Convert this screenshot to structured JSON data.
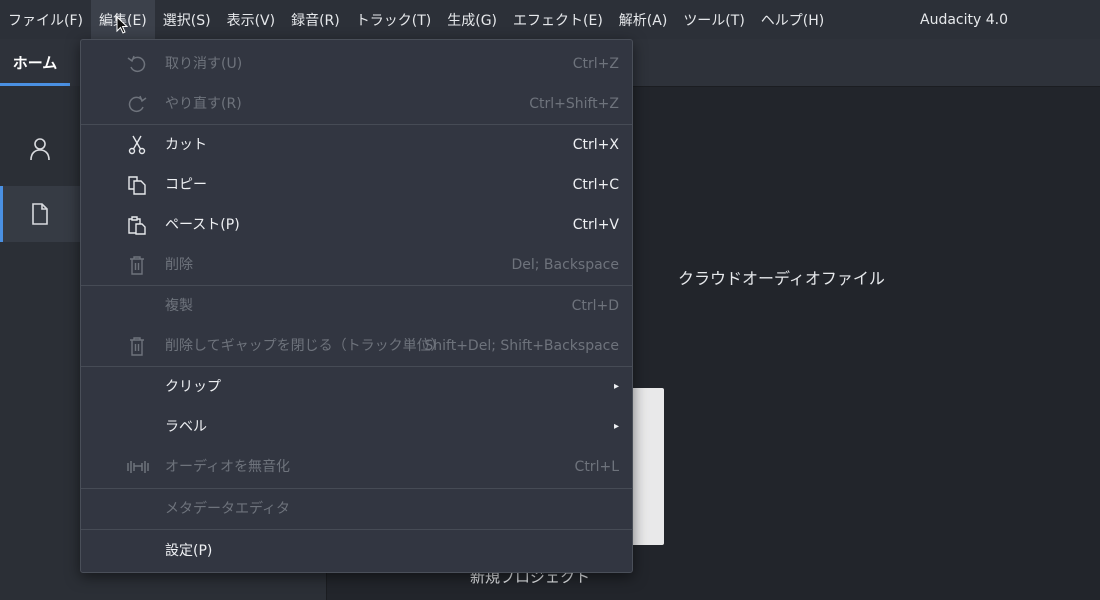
{
  "menubar": {
    "items": [
      "ファイル(F)",
      "編集(E)",
      "選択(S)",
      "表示(V)",
      "録音(R)",
      "トラック(T)",
      "生成(G)",
      "エフェクト(E)",
      "解析(A)",
      "ツール(T)",
      "ヘルプ(H)"
    ],
    "app_title": "Audacity 4.0"
  },
  "tabs": {
    "home": "ホーム"
  },
  "sidebar": {
    "icons": [
      "user-icon",
      "document-icon"
    ]
  },
  "content": {
    "cloud_audio_label": "クラウドオーディオファイル",
    "new_project_label": "新規プロジェクト"
  },
  "edit_menu": {
    "items": [
      {
        "label": "取り消す(U)",
        "shortcut": "Ctrl+Z",
        "enabled": false,
        "icon": "undo-icon"
      },
      {
        "label": "やり直す(R)",
        "shortcut": "Ctrl+Shift+Z",
        "enabled": false,
        "icon": "redo-icon"
      },
      {
        "label": "カット",
        "shortcut": "Ctrl+X",
        "enabled": true,
        "icon": "scissors-icon"
      },
      {
        "label": "コピー",
        "shortcut": "Ctrl+C",
        "enabled": true,
        "icon": "copy-icon"
      },
      {
        "label": "ペースト(P)",
        "shortcut": "Ctrl+V",
        "enabled": true,
        "icon": "paste-icon"
      },
      {
        "label": "削除",
        "shortcut": "Del; Backspace",
        "enabled": false,
        "icon": "trash-icon"
      },
      {
        "label": "複製",
        "shortcut": "Ctrl+D",
        "enabled": false,
        "icon": ""
      },
      {
        "label": "削除してギャップを閉じる（トラック単位）",
        "shortcut": "Shift+Del; Shift+Backspace",
        "enabled": false,
        "icon": "trash-icon"
      },
      {
        "label": "クリップ",
        "shortcut": "",
        "enabled": true,
        "icon": "",
        "submenu": true
      },
      {
        "label": "ラベル",
        "shortcut": "",
        "enabled": true,
        "icon": "",
        "submenu": true
      },
      {
        "label": "オーディオを無音化",
        "shortcut": "Ctrl+L",
        "enabled": false,
        "icon": "silence-icon"
      },
      {
        "label": "メタデータエディタ",
        "shortcut": "",
        "enabled": false,
        "icon": ""
      },
      {
        "label": "設定(P)",
        "shortcut": "",
        "enabled": true,
        "icon": ""
      }
    ],
    "submenu_arrow": "▸"
  },
  "colors": {
    "accent": "#4a90e2",
    "menu_bg": "#323641",
    "bg": "#22252b"
  }
}
